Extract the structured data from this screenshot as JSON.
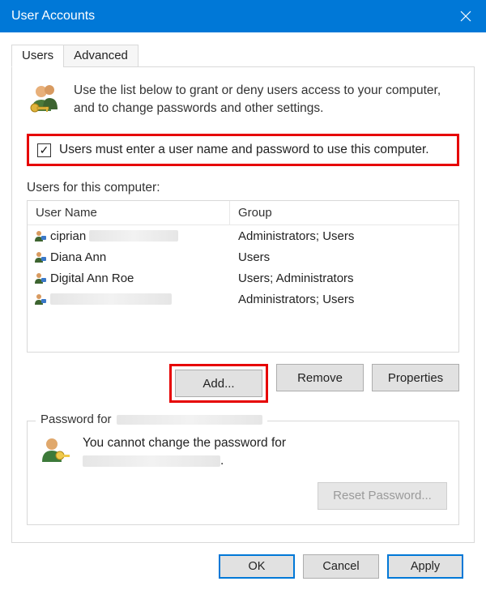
{
  "titlebar": {
    "title": "User Accounts"
  },
  "tabs": {
    "users": "Users",
    "advanced": "Advanced"
  },
  "intro": {
    "text": "Use the list below to grant or deny users access to your computer, and to change passwords and other settings."
  },
  "checkbox": {
    "checked": true,
    "label": "Users must enter a user name and password to use this computer."
  },
  "users_section": {
    "label": "Users for this computer:",
    "headers": {
      "name": "User Name",
      "group": "Group"
    },
    "rows": [
      {
        "name": "ciprian",
        "group": "Administrators; Users",
        "redacted_after_name": true
      },
      {
        "name": "Diana Ann",
        "group": "Users",
        "redacted_after_name": false
      },
      {
        "name": "Digital Ann Roe",
        "group": "Users; Administrators",
        "redacted_after_name": false
      },
      {
        "name": "",
        "group": "Administrators; Users",
        "redacted_after_name": true
      }
    ]
  },
  "buttons": {
    "add": "Add...",
    "remove": "Remove",
    "properties": "Properties"
  },
  "password_box": {
    "legend_prefix": "Password for",
    "body_line1": "You cannot change the password for",
    "body_line2_suffix": ".",
    "reset": "Reset Password..."
  },
  "dialog_buttons": {
    "ok": "OK",
    "cancel": "Cancel",
    "apply": "Apply"
  }
}
